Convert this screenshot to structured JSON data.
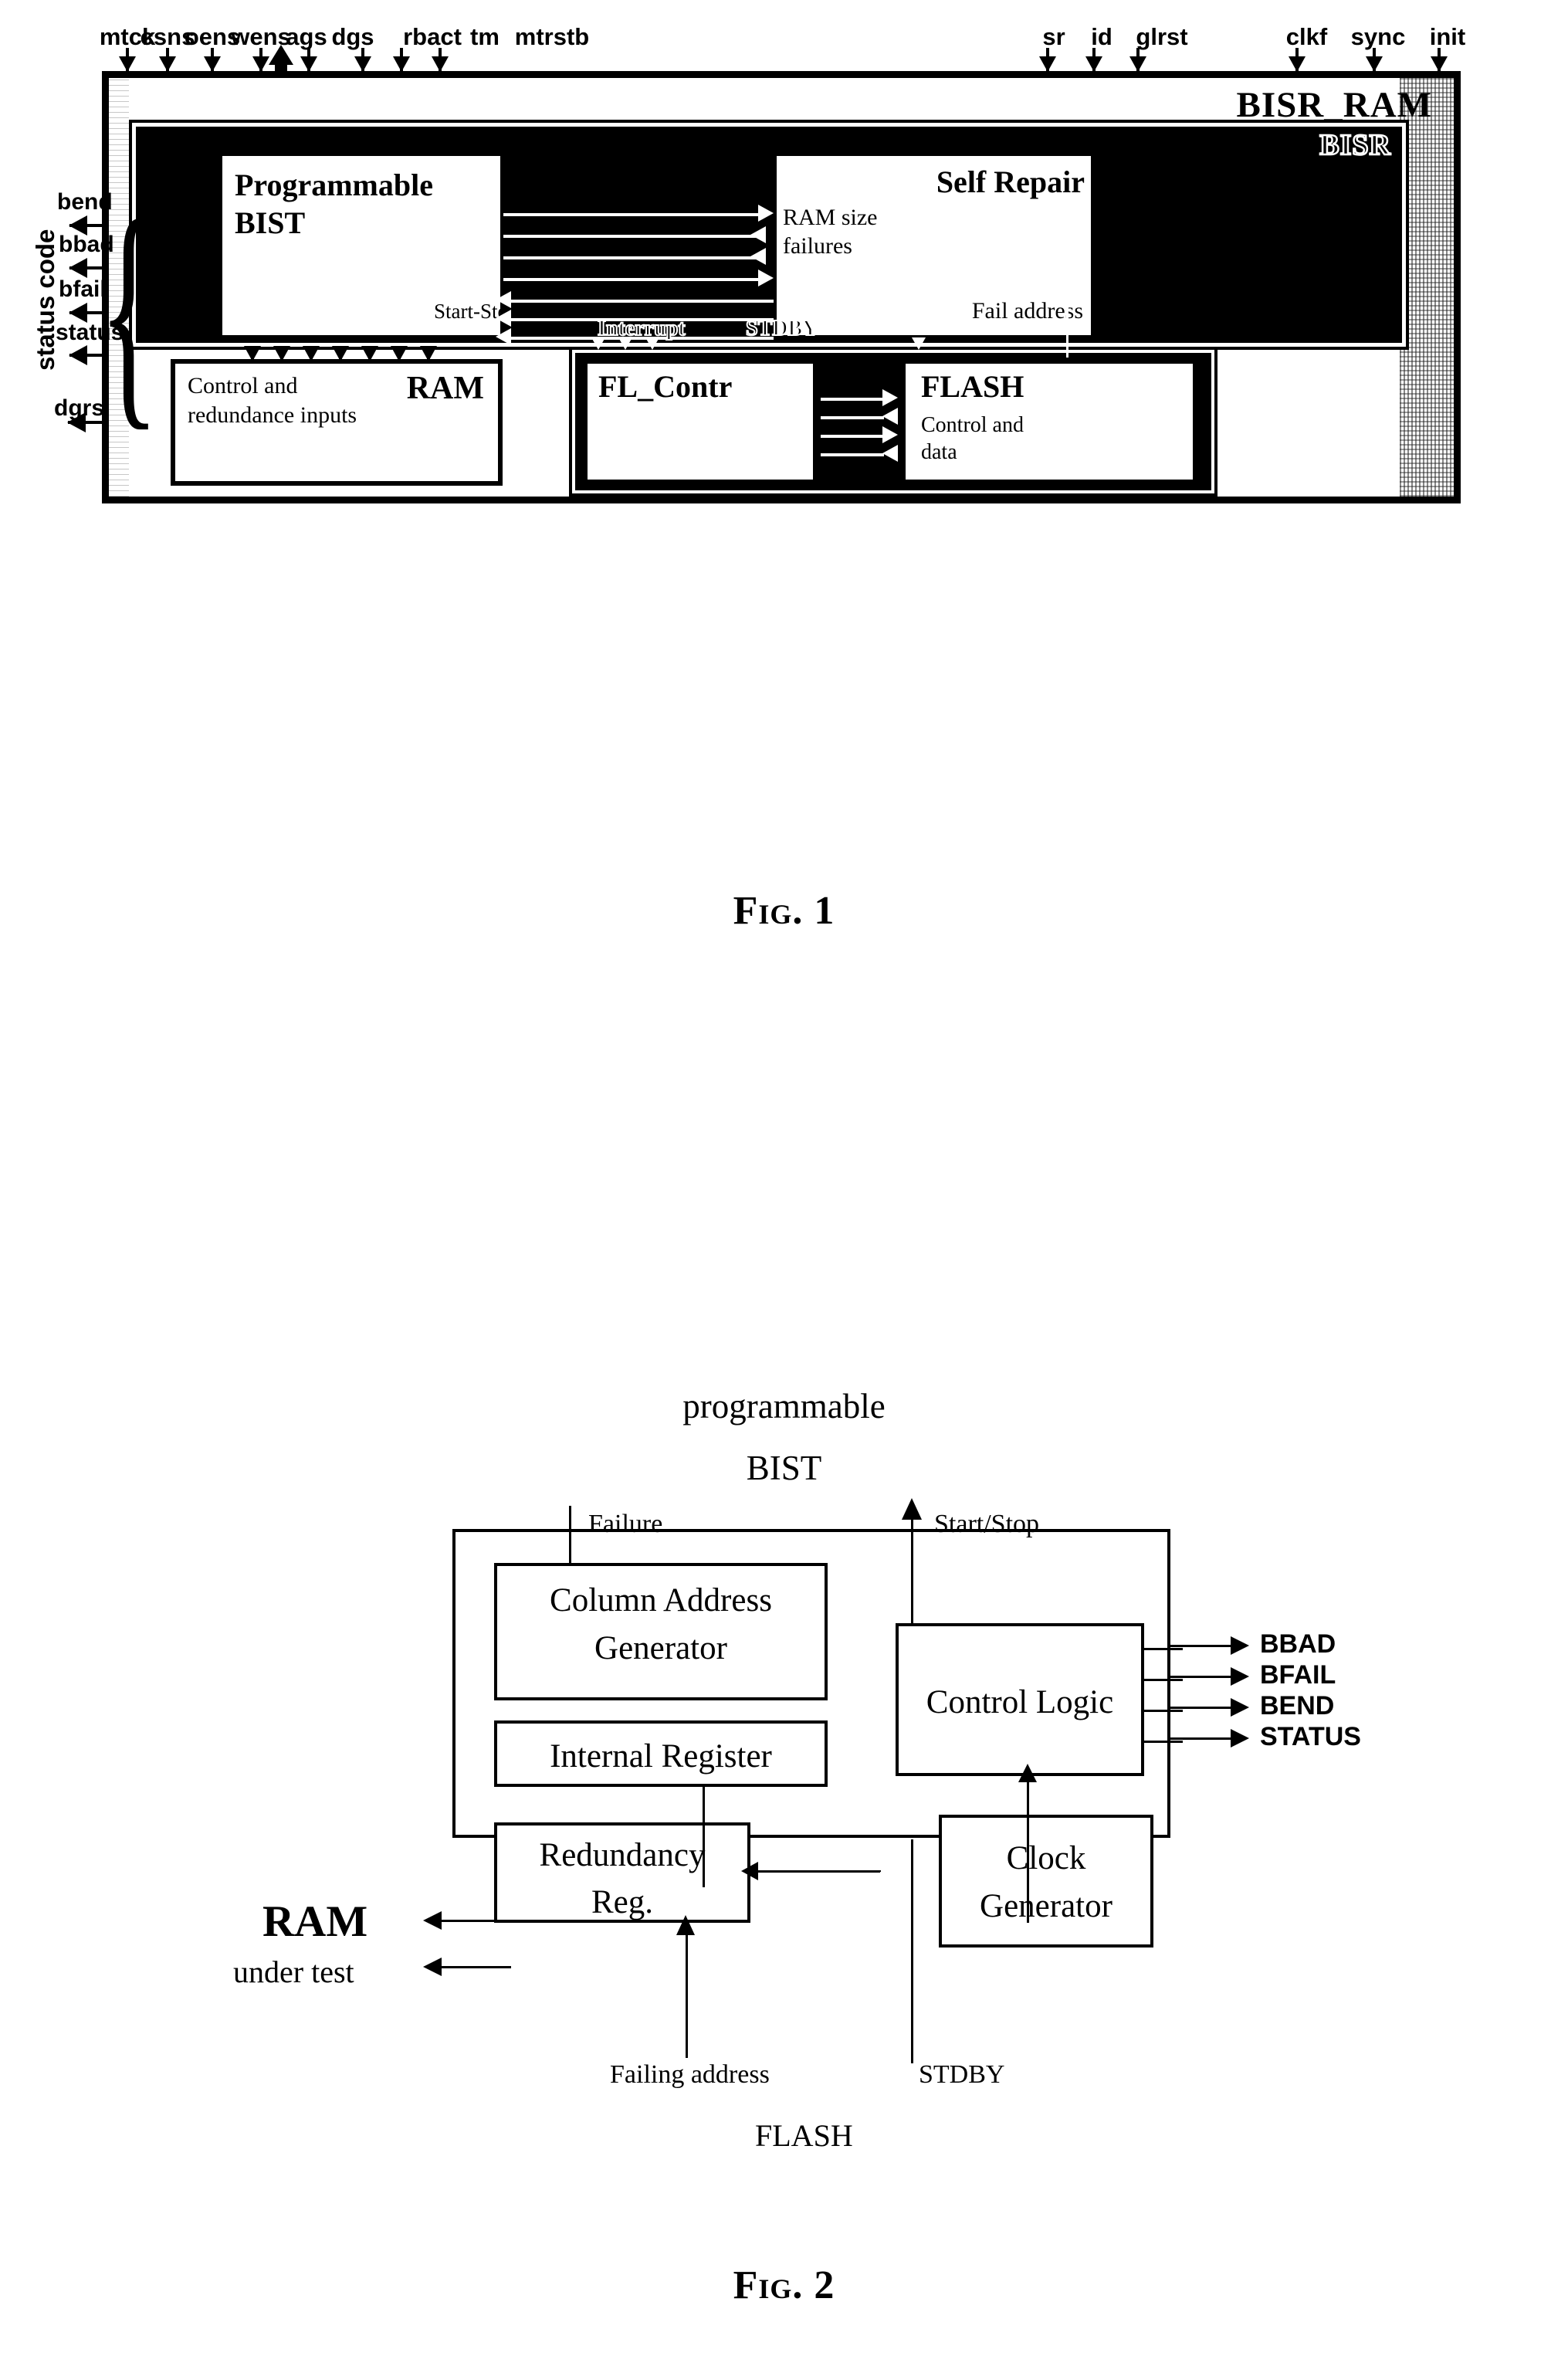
{
  "figure1": {
    "caption": "Fig. 1",
    "outer_block_title": "BISR_RAM",
    "bisr_block_title": "BISR",
    "top_signals": [
      {
        "name": "mtck",
        "direction": "in"
      },
      {
        "name": "csns",
        "direction": "in"
      },
      {
        "name": "oens",
        "direction": "in"
      },
      {
        "name": "wens",
        "direction": "in"
      },
      {
        "name": "ags",
        "direction": "bidirectional"
      },
      {
        "name": "dgs",
        "direction": "bidirectional"
      },
      {
        "name": "rbact",
        "direction": "in"
      },
      {
        "name": "tm",
        "direction": "in"
      },
      {
        "name": "mtrstb",
        "direction": "in"
      },
      {
        "name": "sr",
        "direction": "in"
      },
      {
        "name": "id",
        "direction": "in"
      },
      {
        "name": "glrst",
        "direction": "in"
      },
      {
        "name": "clkf",
        "direction": "in"
      },
      {
        "name": "sync",
        "direction": "in"
      },
      {
        "name": "init",
        "direction": "in"
      }
    ],
    "left_signals": [
      {
        "name": "bend",
        "direction": "out"
      },
      {
        "name": "bbad",
        "direction": "out"
      },
      {
        "name": "bfail",
        "direction": "out"
      },
      {
        "name": "status",
        "direction": "out"
      },
      {
        "name": "dgrs",
        "direction": "out"
      }
    ],
    "status_code_label": "status code",
    "blocks": {
      "programmable_bist": {
        "line1": "Programmable",
        "line2": "BIST"
      },
      "self_repair": {
        "title": "Self Repair",
        "input_label_line1": "RAM size",
        "input_label_line2": "failures",
        "fail_address_label": "Fail address"
      },
      "start_stop_label": "Start-Stop",
      "interrupt_label": "Interrupt",
      "stdby_label": "STDBY",
      "ram": {
        "title": "RAM",
        "note_line1": "Control and",
        "note_line2": "redundance inputs"
      },
      "fl_contr": {
        "title": "FL_Contr"
      },
      "flash": {
        "title": "FLASH",
        "note_line1": "Control and",
        "note_line2": "data"
      }
    }
  },
  "figure2": {
    "caption": "Fig. 2",
    "title_line1": "programmable",
    "title_line2": "BIST",
    "input_arrows": [
      {
        "label": "Failure",
        "direction": "down"
      },
      {
        "label": "Start/Stop",
        "direction": "up"
      }
    ],
    "blocks": [
      {
        "id": "column-address-generator",
        "line1": "Column Address",
        "line2": "Generator"
      },
      {
        "id": "internal-register",
        "line1": "Internal Register"
      },
      {
        "id": "redundancy-reg",
        "line1": "Redundancy",
        "line2": "Reg."
      },
      {
        "id": "control-logic",
        "line1": "Control Logic"
      },
      {
        "id": "clock-generator",
        "line1": "Clock",
        "line2": "Generator"
      }
    ],
    "outputs": [
      "BBAD",
      "BFAIL",
      "BEND",
      "STATUS"
    ],
    "external_left": {
      "line1": "RAM",
      "line2": "under test"
    },
    "bottom_labels": [
      {
        "label": "Failing address"
      },
      {
        "label": "STDBY"
      },
      {
        "label": "FLASH"
      }
    ]
  }
}
